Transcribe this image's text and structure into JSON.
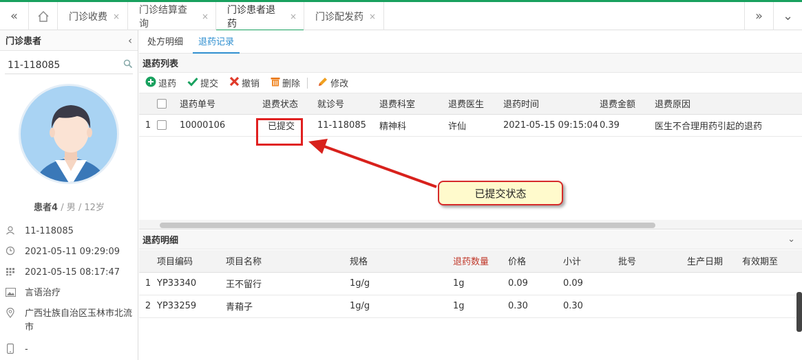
{
  "topbar": {
    "tabs": [
      {
        "label": "门诊收费"
      },
      {
        "label": "门诊结算查询"
      },
      {
        "label": "门诊患者退药"
      },
      {
        "label": "门诊配发药"
      }
    ],
    "close_glyph": "×"
  },
  "left": {
    "title": "门诊患者",
    "search_value": "11-118085",
    "patient_name": "患者4",
    "patient_meta": " / 男 / 12岁",
    "info": [
      {
        "icon": "user-icon",
        "text": "11-118085"
      },
      {
        "icon": "clock-icon",
        "text": "2021-05-11 09:29:09"
      },
      {
        "icon": "calendar-icon",
        "text": "2021-05-15 08:17:47"
      },
      {
        "icon": "image-icon",
        "text": "言语治疗"
      },
      {
        "icon": "location-icon",
        "text": "广西壮族自治区玉林市北流市"
      },
      {
        "icon": "phone-icon",
        "text": "-"
      }
    ]
  },
  "main": {
    "subtabs": [
      {
        "label": "处方明细"
      },
      {
        "label": "退药记录"
      }
    ],
    "list_title": "退药列表",
    "toolbar": {
      "refund": "退药",
      "submit": "提交",
      "revoke": "撤销",
      "delete": "删除",
      "edit": "修改"
    },
    "list_headers": [
      "退药单号",
      "退费状态",
      "就诊号",
      "退费科室",
      "退费医生",
      "退药时间",
      "退费金额",
      "退费原因"
    ],
    "list_rows": [
      {
        "no": "1",
        "cells": [
          "10000106",
          "已提交",
          "11-118085",
          "精神科",
          "许仙",
          "2021-05-15 09:15:04",
          "0.39",
          "医生不合理用药引起的退药"
        ]
      }
    ],
    "detail_title": "退药明细",
    "detail_headers": [
      "项目编码",
      "项目名称",
      "规格",
      "退药数量",
      "价格",
      "小计",
      "批号",
      "生产日期",
      "有效期至"
    ],
    "detail_rows": [
      {
        "no": "1",
        "cells": [
          "YP33340",
          "王不留行",
          "1g/g",
          "1g",
          "0.09",
          "0.09",
          "",
          "",
          ""
        ]
      },
      {
        "no": "2",
        "cells": [
          "YP33259",
          "青葙子",
          "1g/g",
          "1g",
          "0.30",
          "0.30",
          "",
          "",
          ""
        ]
      }
    ]
  },
  "annotation": {
    "callout": "已提交状态"
  },
  "colors": {
    "accent": "#19a15f",
    "link": "#2f8fd0",
    "highlight": "#e02020",
    "required_header": "#c0392b"
  }
}
